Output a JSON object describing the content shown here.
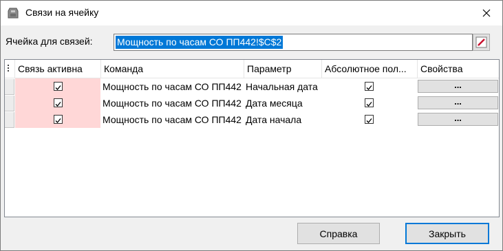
{
  "window": {
    "title": "Связи на ячейку",
    "icon": "paint-bucket-icon",
    "close_label": "✕"
  },
  "cell": {
    "label": "Ячейка для связей:",
    "value": "Мощность по часам СО ПП442!$C$2",
    "picker_icon": "range-picker-icon"
  },
  "grid": {
    "columns": {
      "active": "Связь активна",
      "command": "Команда",
      "parameter": "Параметр",
      "absolute": "Абсолютное пол...",
      "properties": "Свойства"
    },
    "rows": [
      {
        "active": true,
        "command": "Мощность по часам СО ПП442",
        "parameter": "Начальная дата",
        "absolute": true,
        "properties": "..."
      },
      {
        "active": true,
        "command": "Мощность по часам СО ПП442",
        "parameter": "Дата месяца",
        "absolute": true,
        "properties": "..."
      },
      {
        "active": true,
        "command": "Мощность по часам СО ПП442",
        "parameter": "Дата начала",
        "absolute": true,
        "properties": "..."
      }
    ]
  },
  "buttons": {
    "help": "Справка",
    "close": "Закрыть"
  },
  "colors": {
    "selection": "#0078d7",
    "active_cell_bg": "#ffd7d7"
  }
}
